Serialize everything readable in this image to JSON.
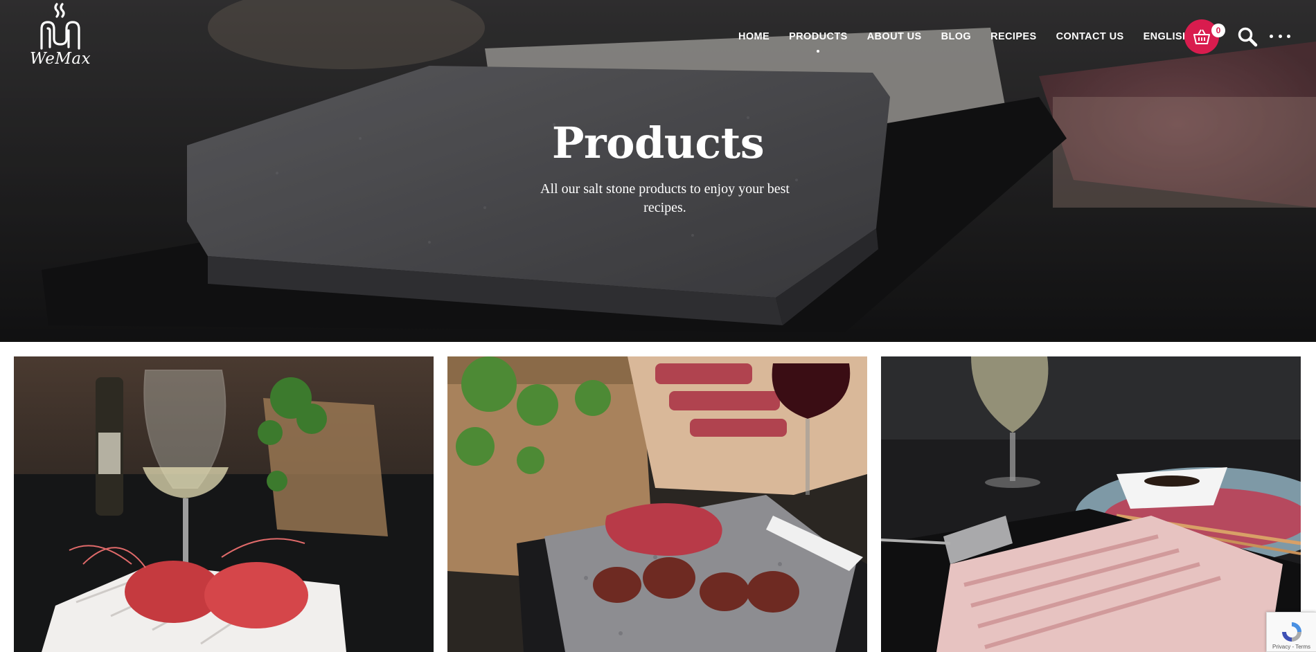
{
  "brand": {
    "name": "WeMax"
  },
  "nav": {
    "items": [
      {
        "label": "HOME",
        "active": false
      },
      {
        "label": "PRODUCTS",
        "active": true
      },
      {
        "label": "ABOUT US",
        "active": false
      },
      {
        "label": "BLOG",
        "active": false
      },
      {
        "label": "RECIPES",
        "active": false
      },
      {
        "label": "CONTACT US",
        "active": false
      },
      {
        "label": "ENGLISH",
        "active": false
      }
    ],
    "cart_count": "0",
    "icons": [
      "cart-icon",
      "search-icon",
      "more-dots-icon"
    ]
  },
  "hero": {
    "title": "Products",
    "subtitle": "All our salt stone products to enjoy your best recipes."
  },
  "products": [
    {
      "image": "prawns-on-white-salt-stone"
    },
    {
      "image": "steak-on-granite-stone"
    },
    {
      "image": "pink-salt-stone-plate"
    }
  ],
  "recaptcha": {
    "label": "Privacy - Terms"
  },
  "colors": {
    "accent": "#d91c4e",
    "text_on_hero": "#ffffff"
  }
}
